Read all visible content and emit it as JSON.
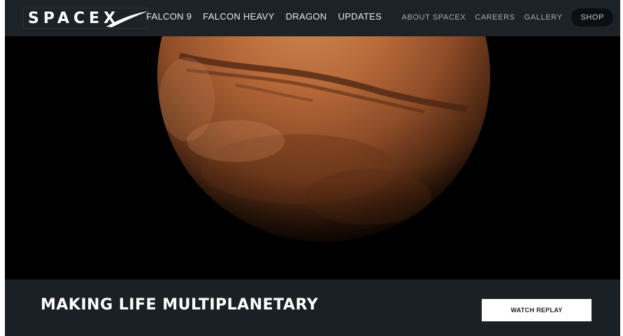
{
  "nav": {
    "logo_text": "SPACEX",
    "primary": [
      {
        "label": "FALCON 9"
      },
      {
        "label": "FALCON HEAVY"
      },
      {
        "label": "DRAGON"
      },
      {
        "label": "UPDATES"
      }
    ],
    "secondary": [
      {
        "label": "ABOUT SPACEX"
      },
      {
        "label": "CAREERS"
      },
      {
        "label": "GALLERY"
      }
    ],
    "shop_label": "SHOP"
  },
  "hero": {
    "image": "mars-planet-image"
  },
  "banner": {
    "headline": "MAKING LIFE MULTIPLANETARY",
    "cta_label": "WATCH REPLAY"
  },
  "colors": {
    "nav_bg": "#1d2226",
    "hero_bg": "#000000",
    "banner_bg": "#1b2024",
    "mars": "#b8693a",
    "cta_bg": "#ffffff"
  }
}
